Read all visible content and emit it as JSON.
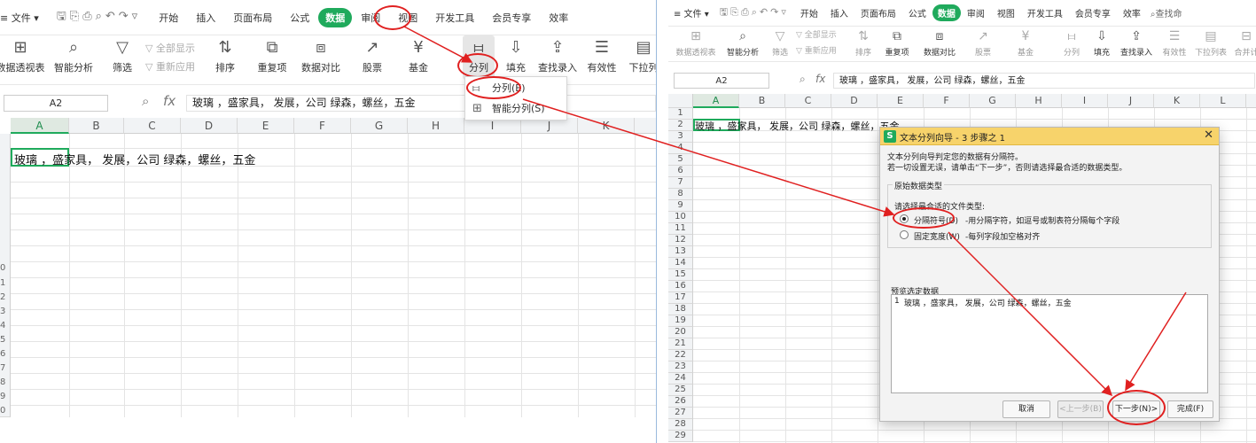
{
  "left": {
    "menu": {
      "file_label": "≡ 文件 ▾",
      "tabs": [
        "开始",
        "插入",
        "页面布局",
        "公式",
        "数据",
        "审阅",
        "视图",
        "开发工具",
        "会员专享",
        "效率"
      ]
    },
    "ribbon": {
      "pivot": "数据透视表",
      "smart_analysis": "智能分析",
      "filter": "筛选",
      "show_all": "全部显示",
      "reapply": "重新应用",
      "sort": "排序",
      "duplicates": "重复项",
      "compare": "数据对比",
      "stock": "股票",
      "fund": "基金",
      "split": "分列",
      "fill": "填充",
      "lookup": "查找录入",
      "validity": "有效性",
      "dropdown_list": "下拉列"
    },
    "formula_bar": {
      "name_box": "A2",
      "fx": "fx",
      "content": "玻璃 ，盛家具，  发展，公司 绿森，螺丝，五金"
    },
    "columns": [
      "A",
      "B",
      "C",
      "D",
      "E",
      "F",
      "G",
      "H",
      "I",
      "J",
      "K"
    ],
    "cell_text": "玻璃 ，盛家具，  发展，公司 绿森，螺丝，五金",
    "row_fragments": [
      "0",
      "1",
      "2",
      "3",
      "4",
      "5",
      "6",
      "7",
      "8",
      "9",
      "0"
    ],
    "dropdown": {
      "items": [
        "分列(E)",
        "智能分列(S)"
      ]
    }
  },
  "right": {
    "menu": {
      "file_label": "≡ 文件 ▾",
      "tabs": [
        "开始",
        "插入",
        "页面布局",
        "公式",
        "数据",
        "审阅",
        "视图",
        "开发工具",
        "会员专享",
        "效率"
      ],
      "search": "查找命"
    },
    "ribbon": {
      "pivot": "数据透视表",
      "smart_analysis": "智能分析",
      "filter": "筛选",
      "show_all": "全部显示",
      "reapply": "重新应用",
      "sort": "排序",
      "duplicates": "重复项",
      "compare": "数据对比",
      "stock": "股票",
      "fund": "基金",
      "split": "分列",
      "fill": "填充",
      "lookup": "查找录入",
      "validity": "有效性",
      "dropdown_list": "下拉列表",
      "merge": "合并计"
    },
    "formula_bar": {
      "name_box": "A2",
      "content": "玻璃 ，盛家具，  发展，公司 绿森，螺丝，五金"
    },
    "columns": [
      "A",
      "B",
      "C",
      "D",
      "E",
      "F",
      "G",
      "H",
      "I",
      "J",
      "K",
      "L"
    ],
    "rows": [
      "1",
      "2",
      "3",
      "4",
      "5",
      "6",
      "7",
      "8",
      "9",
      "10",
      "11",
      "12",
      "13",
      "14",
      "15",
      "16",
      "17",
      "18",
      "19",
      "20",
      "21",
      "22",
      "23",
      "24",
      "25",
      "26",
      "27",
      "28",
      "29"
    ],
    "cell_text": "玻璃 ，盛家具，  发展，公司 绿森，螺丝，五金"
  },
  "dialog": {
    "icon": "S",
    "title": "文本分列向导 - 3 步骤之 1",
    "close": "✕",
    "intro1": "文本分列向导判定您的数据有分隔符。",
    "intro2": "若一切设置无误，请单击“下一步”，否则请选择最合适的数据类型。",
    "group_label": "原始数据类型",
    "choose_label": "请选择最合适的文件类型:",
    "option1_label": "分隔符号(D)",
    "option1_desc": "-用分隔字符，如逗号或制表符分隔每个字段",
    "option2_label": "固定宽度(W)",
    "option2_desc": "-每列字段加空格对齐",
    "preview_label": "预览选定数据",
    "preview_row_num": "1",
    "preview_text": "玻璃 ，盛家具，  发展，公司 绿森，螺丝，五金",
    "cancel": "取消",
    "prev": "<上一步(B)",
    "next": "下一步(N)>",
    "finish": "完成(F)"
  },
  "colors": {
    "accent_green": "#1faa5c",
    "annotation_red": "#e02020",
    "dialog_title": "#f7d36b"
  }
}
